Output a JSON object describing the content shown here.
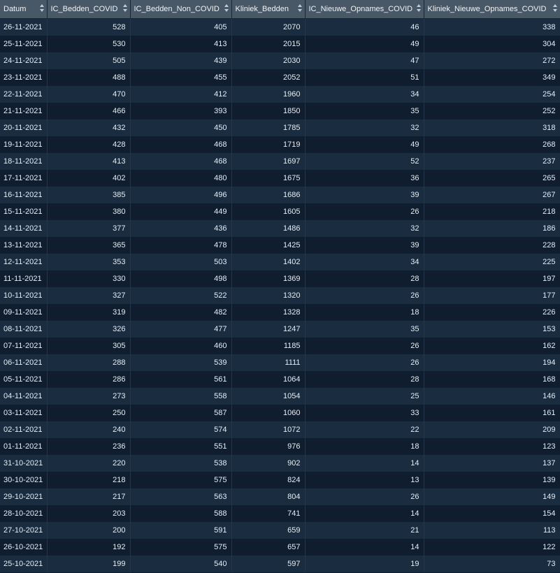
{
  "columns": [
    "Datum",
    "IC_Bedden_COVID",
    "IC_Bedden_Non_COVID",
    "Kliniek_Bedden",
    "IC_Nieuwe_Opnames_COVID",
    "Kliniek_Nieuwe_Opnames_COVID"
  ],
  "rows": [
    [
      "26-11-2021",
      "528",
      "405",
      "2070",
      "46",
      "338"
    ],
    [
      "25-11-2021",
      "530",
      "413",
      "2015",
      "49",
      "304"
    ],
    [
      "24-11-2021",
      "505",
      "439",
      "2030",
      "47",
      "272"
    ],
    [
      "23-11-2021",
      "488",
      "455",
      "2052",
      "51",
      "349"
    ],
    [
      "22-11-2021",
      "470",
      "412",
      "1960",
      "34",
      "254"
    ],
    [
      "21-11-2021",
      "466",
      "393",
      "1850",
      "35",
      "252"
    ],
    [
      "20-11-2021",
      "432",
      "450",
      "1785",
      "32",
      "318"
    ],
    [
      "19-11-2021",
      "428",
      "468",
      "1719",
      "49",
      "268"
    ],
    [
      "18-11-2021",
      "413",
      "468",
      "1697",
      "52",
      "237"
    ],
    [
      "17-11-2021",
      "402",
      "480",
      "1675",
      "36",
      "265"
    ],
    [
      "16-11-2021",
      "385",
      "496",
      "1686",
      "39",
      "267"
    ],
    [
      "15-11-2021",
      "380",
      "449",
      "1605",
      "26",
      "218"
    ],
    [
      "14-11-2021",
      "377",
      "436",
      "1486",
      "32",
      "186"
    ],
    [
      "13-11-2021",
      "365",
      "478",
      "1425",
      "39",
      "228"
    ],
    [
      "12-11-2021",
      "353",
      "503",
      "1402",
      "34",
      "225"
    ],
    [
      "11-11-2021",
      "330",
      "498",
      "1369",
      "28",
      "197"
    ],
    [
      "10-11-2021",
      "327",
      "522",
      "1320",
      "26",
      "177"
    ],
    [
      "09-11-2021",
      "319",
      "482",
      "1328",
      "18",
      "226"
    ],
    [
      "08-11-2021",
      "326",
      "477",
      "1247",
      "35",
      "153"
    ],
    [
      "07-11-2021",
      "305",
      "460",
      "1185",
      "26",
      "162"
    ],
    [
      "06-11-2021",
      "288",
      "539",
      "1111",
      "26",
      "194"
    ],
    [
      "05-11-2021",
      "286",
      "561",
      "1064",
      "28",
      "168"
    ],
    [
      "04-11-2021",
      "273",
      "558",
      "1054",
      "25",
      "146"
    ],
    [
      "03-11-2021",
      "250",
      "587",
      "1060",
      "33",
      "161"
    ],
    [
      "02-11-2021",
      "240",
      "574",
      "1072",
      "22",
      "209"
    ],
    [
      "01-11-2021",
      "236",
      "551",
      "976",
      "18",
      "123"
    ],
    [
      "31-10-2021",
      "220",
      "538",
      "902",
      "14",
      "137"
    ],
    [
      "30-10-2021",
      "218",
      "575",
      "824",
      "13",
      "139"
    ],
    [
      "29-10-2021",
      "217",
      "563",
      "804",
      "26",
      "149"
    ],
    [
      "28-10-2021",
      "203",
      "588",
      "741",
      "14",
      "154"
    ],
    [
      "27-10-2021",
      "200",
      "591",
      "659",
      "21",
      "113"
    ],
    [
      "26-10-2021",
      "192",
      "575",
      "657",
      "14",
      "122"
    ],
    [
      "25-10-2021",
      "199",
      "540",
      "597",
      "19",
      "73"
    ]
  ],
  "icons": {
    "sort": "sort-arrows-icon"
  },
  "colors": {
    "header_bg": "#495866",
    "row_odd": "#1a2c40",
    "row_even": "#0f1d2e",
    "text": "#e6edf3"
  }
}
